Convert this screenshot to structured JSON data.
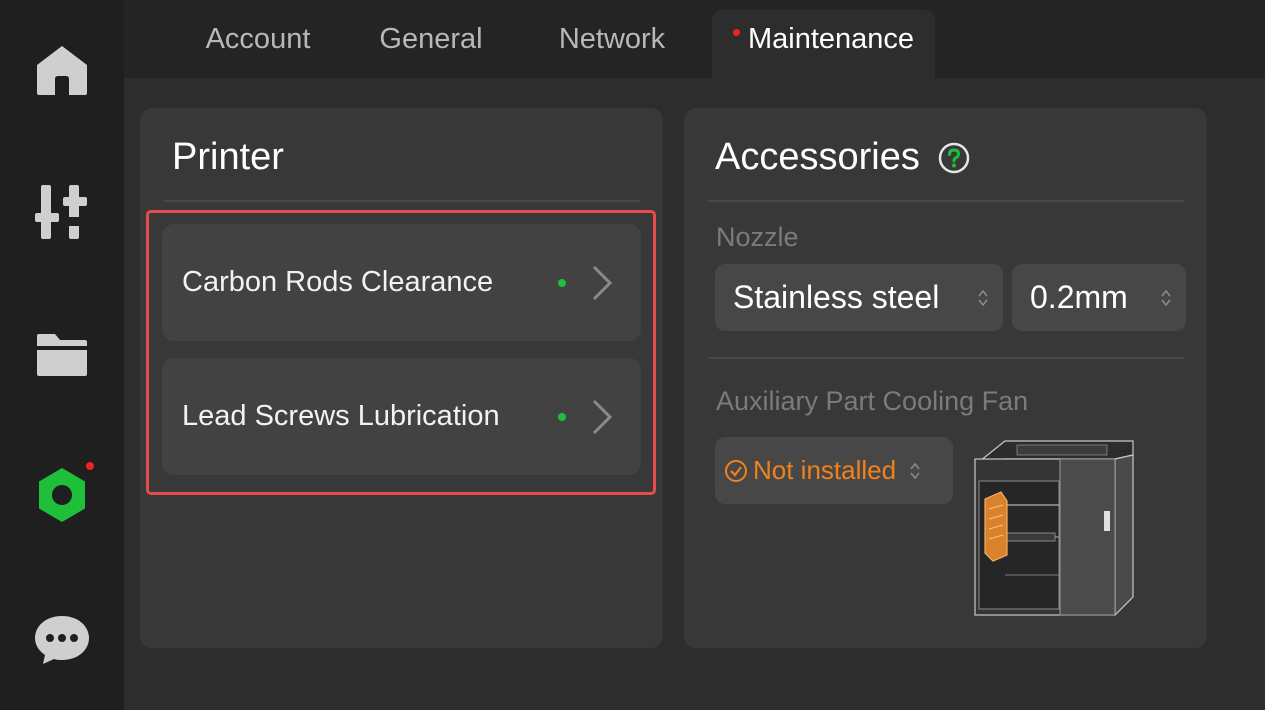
{
  "sidebar": {
    "items": [
      {
        "name": "home",
        "icon": "home-icon"
      },
      {
        "name": "controls",
        "icon": "sliders-icon"
      },
      {
        "name": "files",
        "icon": "folder-icon"
      },
      {
        "name": "settings",
        "icon": "nut-icon",
        "active": true,
        "notification": true
      },
      {
        "name": "messages",
        "icon": "chat-bubble-icon"
      }
    ]
  },
  "tabs": [
    {
      "label": "Account"
    },
    {
      "label": "General"
    },
    {
      "label": "Network"
    },
    {
      "label": "Maintenance",
      "active": true,
      "notification": true
    }
  ],
  "printer": {
    "title": "Printer",
    "items": [
      {
        "label": "Carbon Rods Clearance",
        "status": "ok"
      },
      {
        "label": "Lead Screws Lubrication",
        "status": "ok"
      }
    ]
  },
  "accessories": {
    "title": "Accessories",
    "nozzle": {
      "label": "Nozzle",
      "material": "Stainless steel",
      "diameter": "0.2mm"
    },
    "fan": {
      "label": "Auxiliary Part Cooling Fan",
      "value": "Not installed"
    }
  },
  "colors": {
    "accent_green": "#1fbf3a",
    "alert_red": "#ee2323",
    "warning_orange": "#f0821e",
    "highlight_border": "#e84b4b"
  }
}
